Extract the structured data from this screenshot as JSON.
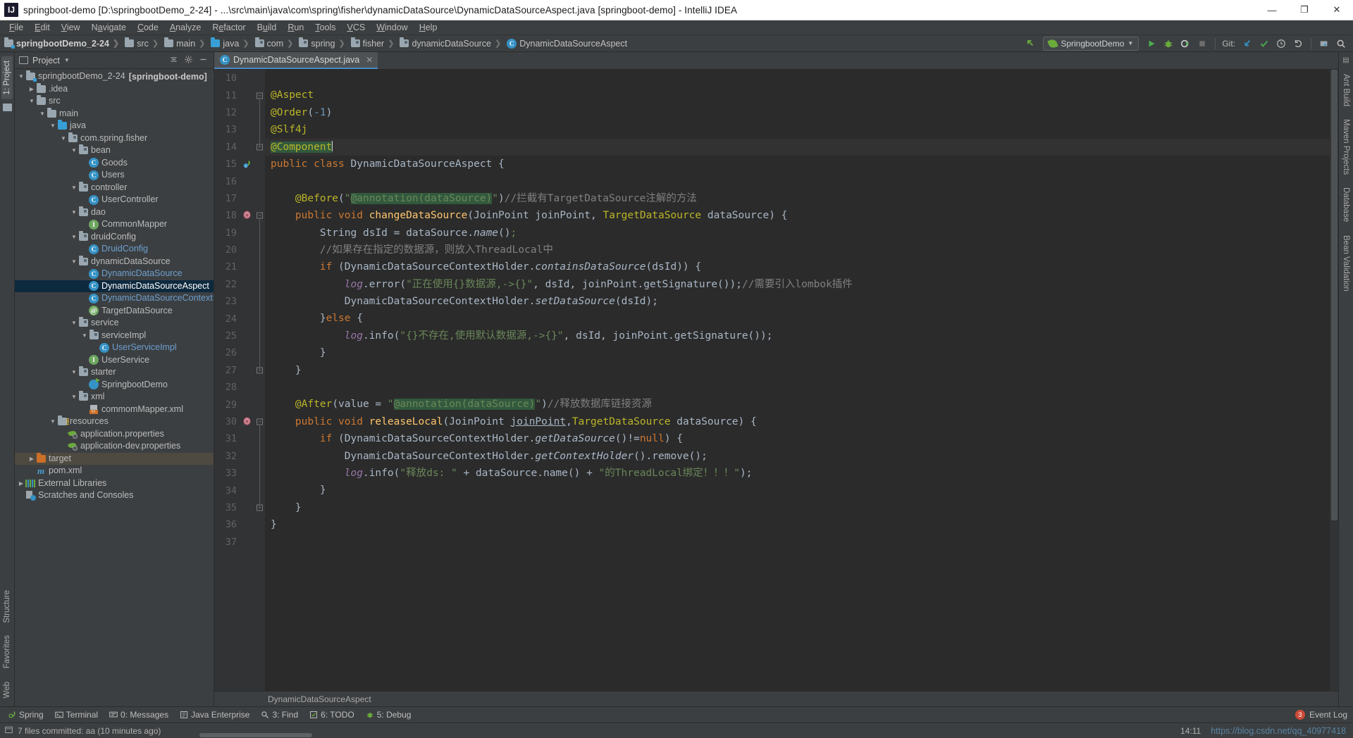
{
  "window": {
    "title": "springboot-demo [D:\\springbootDemo_2-24] - ...\\src\\main\\java\\com\\spring\\fisher\\dynamicDataSource\\DynamicDataSourceAspect.java [springboot-demo] - IntelliJ IDEA",
    "logo_text": "IJ",
    "minimize": "—",
    "maximize": "❐",
    "close": "✕"
  },
  "menubar": {
    "items": [
      "File",
      "Edit",
      "View",
      "Navigate",
      "Code",
      "Analyze",
      "Refactor",
      "Build",
      "Run",
      "Tools",
      "VCS",
      "Window",
      "Help"
    ]
  },
  "navbar": {
    "crumbs": [
      {
        "label": "springbootDemo_2-24",
        "icon": "folder-module-icon",
        "bold": true,
        "kind": "module"
      },
      {
        "label": "src",
        "icon": "folder-icon",
        "bold": false,
        "kind": "folder"
      },
      {
        "label": "main",
        "icon": "folder-icon",
        "bold": false,
        "kind": "folder"
      },
      {
        "label": "java",
        "icon": "folder-source-icon",
        "bold": false,
        "kind": "source"
      },
      {
        "label": "com",
        "icon": "folder-package-icon",
        "bold": false,
        "kind": "package"
      },
      {
        "label": "spring",
        "icon": "folder-package-icon",
        "bold": false,
        "kind": "package"
      },
      {
        "label": "fisher",
        "icon": "folder-package-icon",
        "bold": false,
        "kind": "package"
      },
      {
        "label": "dynamicDataSource",
        "icon": "folder-package-icon",
        "bold": false,
        "kind": "package"
      },
      {
        "label": "DynamicDataSourceAspect",
        "icon": "class-icon",
        "bold": false,
        "kind": "class"
      }
    ],
    "run_config": "SpringbootDemo",
    "git_label": "Git:",
    "icons": {
      "back_arrow": "up-left-arrow-icon",
      "run": "run-icon",
      "debug": "debug-icon",
      "run_coverage": "run-with-coverage-icon",
      "stop": "stop-icon",
      "update": "git-update-icon",
      "commit": "git-commit-icon",
      "history": "git-history-icon",
      "rollback": "git-rollback-icon",
      "project_struct": "project-structure-icon",
      "search": "search-everywhere-icon"
    }
  },
  "left_strips": [
    "1: Project",
    "Structure",
    "Favorites",
    "Web"
  ],
  "right_strips": [
    "Ant Build",
    "Maven Projects",
    "Database",
    "Bean Validation"
  ],
  "project_panel": {
    "title": "Project",
    "tree": [
      {
        "depth": 0,
        "tri": "▼",
        "icon": "module-icon",
        "label": "springbootDemo_2-24",
        "bold_suffix": "[springboot-demo]",
        "path": "D:\\spring",
        "state": "normal"
      },
      {
        "depth": 1,
        "tri": "▶",
        "icon": "folder-icon",
        "label": ".idea",
        "state": "normal"
      },
      {
        "depth": 1,
        "tri": "▼",
        "icon": "folder-icon",
        "label": "src",
        "state": "normal"
      },
      {
        "depth": 2,
        "tri": "▼",
        "icon": "folder-icon",
        "label": "main",
        "state": "normal"
      },
      {
        "depth": 3,
        "tri": "▼",
        "icon": "folder-source-icon",
        "label": "java",
        "state": "normal"
      },
      {
        "depth": 4,
        "tri": "▼",
        "icon": "folder-package-icon",
        "label": "com.spring.fisher",
        "state": "normal"
      },
      {
        "depth": 5,
        "tri": "▼",
        "icon": "folder-package-icon",
        "label": "bean",
        "state": "normal"
      },
      {
        "depth": 6,
        "tri": "",
        "icon": "class-icon",
        "label": "Goods",
        "state": "normal"
      },
      {
        "depth": 6,
        "tri": "",
        "icon": "class-icon",
        "label": "Users",
        "state": "normal"
      },
      {
        "depth": 5,
        "tri": "▼",
        "icon": "folder-package-icon",
        "label": "controller",
        "state": "normal"
      },
      {
        "depth": 6,
        "tri": "",
        "icon": "class-icon",
        "label": "UserController",
        "state": "normal"
      },
      {
        "depth": 5,
        "tri": "▼",
        "icon": "folder-package-icon",
        "label": "dao",
        "state": "normal"
      },
      {
        "depth": 6,
        "tri": "",
        "icon": "interface-icon",
        "label": "CommonMapper",
        "state": "normal"
      },
      {
        "depth": 5,
        "tri": "▼",
        "icon": "folder-package-icon",
        "label": "druidConfig",
        "state": "normal"
      },
      {
        "depth": 6,
        "tri": "",
        "icon": "class-icon",
        "label": "DruidConfig",
        "state": "blue"
      },
      {
        "depth": 5,
        "tri": "▼",
        "icon": "folder-package-icon",
        "label": "dynamicDataSource",
        "state": "normal"
      },
      {
        "depth": 6,
        "tri": "",
        "icon": "class-icon",
        "label": "DynamicDataSource",
        "state": "blue"
      },
      {
        "depth": 6,
        "tri": "",
        "icon": "class-icon",
        "label": "DynamicDataSourceAspect",
        "state": "selected"
      },
      {
        "depth": 6,
        "tri": "",
        "icon": "class-icon",
        "label": "DynamicDataSourceContextHolder",
        "state": "blue"
      },
      {
        "depth": 6,
        "tri": "",
        "icon": "annotation-icon",
        "label": "TargetDataSource",
        "state": "normal"
      },
      {
        "depth": 5,
        "tri": "▼",
        "icon": "folder-package-icon",
        "label": "service",
        "state": "normal"
      },
      {
        "depth": 6,
        "tri": "▼",
        "icon": "folder-package-icon",
        "label": "serviceImpl",
        "state": "normal"
      },
      {
        "depth": 7,
        "tri": "",
        "icon": "class-icon",
        "label": "UserServiceImpl",
        "state": "blue"
      },
      {
        "depth": 6,
        "tri": "",
        "icon": "interface-icon",
        "label": "UserService",
        "state": "normal"
      },
      {
        "depth": 5,
        "tri": "▼",
        "icon": "folder-package-icon",
        "label": "starter",
        "state": "normal"
      },
      {
        "depth": 6,
        "tri": "",
        "icon": "spring-boot-icon",
        "label": "SpringbootDemo",
        "state": "normal"
      },
      {
        "depth": 5,
        "tri": "▼",
        "icon": "folder-package-icon",
        "label": "xml",
        "state": "normal"
      },
      {
        "depth": 6,
        "tri": "",
        "icon": "xml-file-icon",
        "label": "commomMapper.xml",
        "state": "normal"
      },
      {
        "depth": 3,
        "tri": "▼",
        "icon": "folder-resources-icon",
        "label": "resources",
        "state": "normal"
      },
      {
        "depth": 4,
        "tri": "",
        "icon": "properties-icon",
        "label": "application.properties",
        "state": "normal"
      },
      {
        "depth": 4,
        "tri": "",
        "icon": "properties-icon",
        "label": "application-dev.properties",
        "state": "normal"
      },
      {
        "depth": 1,
        "tri": "▶",
        "icon": "folder-excluded-icon",
        "label": "target",
        "state": "highlighted"
      },
      {
        "depth": 1,
        "tri": "",
        "icon": "maven-icon",
        "label": "pom.xml",
        "state": "normal"
      },
      {
        "depth": 0,
        "tri": "▶",
        "icon": "libraries-icon",
        "label": "External Libraries",
        "state": "normal"
      },
      {
        "depth": 0,
        "tri": "",
        "icon": "scratches-icon",
        "label": "Scratches and Consoles",
        "state": "normal"
      }
    ]
  },
  "editor": {
    "tab": {
      "label": "DynamicDataSourceAspect.java",
      "icon": "class-icon",
      "close": "✕"
    },
    "breadcrumb": "DynamicDataSourceAspect",
    "first_line": 10,
    "lines": [
      {
        "n": 10,
        "html": "",
        "current": false,
        "fold": "",
        "mark": ""
      },
      {
        "n": 11,
        "html": "<span class='ann'>@Aspect</span>",
        "current": false,
        "fold": "minus-top",
        "mark": ""
      },
      {
        "n": 12,
        "html": "<span class='ann'>@Order</span>(<span class='num'>-1</span>)",
        "current": false,
        "fold": "",
        "mark": ""
      },
      {
        "n": 13,
        "html": "<span class='ann'>@Slf4j</span>",
        "current": false,
        "fold": "",
        "mark": ""
      },
      {
        "n": 14,
        "html": "<span class='ann hlbg'>@Component</span><span class='caret'></span>",
        "current": true,
        "fold": "minus-bot",
        "mark": ""
      },
      {
        "n": 15,
        "html": "<span class='kw'>public class</span> <span class='cls'>DynamicDataSourceAspect</span> {",
        "current": false,
        "fold": "",
        "mark": "spring-bean-icon"
      },
      {
        "n": 16,
        "html": "",
        "current": false,
        "fold": "",
        "mark": ""
      },
      {
        "n": 17,
        "html": "    <span class='ann'>@Before</span>(<span class='str'>\"</span><span class='str hlbg'>@annotation(dataSource)</span><span class='str'>\"</span>)<span class='cmt'>//拦截有TargetDataSource注解的方法</span>",
        "current": false,
        "fold": "",
        "mark": ""
      },
      {
        "n": 18,
        "html": "    <span class='kw'>public void</span> <span class='fn'>changeDataSource</span>(<span class='cls'>JoinPoint</span> <span class='param'>joinPoint</span>, <span class='ann'>TargetDataSource</span> <span class='param'>dataSource</span>) {",
        "current": false,
        "fold": "minus-top",
        "mark": "method-override-icon"
      },
      {
        "n": 19,
        "html": "        <span class='cls'>String</span> dsId = dataSource.<span class='sfn'>name</span>()<span class='str'>;</span>",
        "current": false,
        "fold": "",
        "mark": ""
      },
      {
        "n": 20,
        "html": "        <span class='cmt'>//如果存在指定的数据源，则放入ThreadLocal中</span>",
        "current": false,
        "fold": "",
        "mark": ""
      },
      {
        "n": 21,
        "html": "        <span class='kw'>if</span> (DynamicDataSourceContextHolder.<span class='sfn'>containsDataSource</span>(dsId)) {",
        "current": false,
        "fold": "",
        "mark": ""
      },
      {
        "n": 22,
        "html": "            <span class='fld'>log</span>.error(<span class='str'>\"正在使用{}数据源,-&gt;{}\"</span>, dsId, joinPoint.getSignature());<span class='cmt'>//需要引入lombok插件</span>",
        "current": false,
        "fold": "",
        "mark": ""
      },
      {
        "n": 23,
        "html": "            DynamicDataSourceContextHolder.<span class='sfn'>setDataSource</span>(dsId);",
        "current": false,
        "fold": "",
        "mark": ""
      },
      {
        "n": 24,
        "html": "        }<span class='kw'>else</span> {",
        "current": false,
        "fold": "",
        "mark": ""
      },
      {
        "n": 25,
        "html": "            <span class='fld'>log</span>.info(<span class='str'>\"{}不存在,使用默认数据源,-&gt;{}\"</span>, dsId, joinPoint.getSignature());",
        "current": false,
        "fold": "",
        "mark": ""
      },
      {
        "n": 26,
        "html": "        }",
        "current": false,
        "fold": "",
        "mark": ""
      },
      {
        "n": 27,
        "html": "    }",
        "current": false,
        "fold": "minus-bot",
        "mark": ""
      },
      {
        "n": 28,
        "html": "",
        "current": false,
        "fold": "",
        "mark": ""
      },
      {
        "n": 29,
        "html": "    <span class='ann'>@After</span>(value = <span class='str'>\"</span><span class='str hlbg'>@annotation(dataSource)</span><span class='str'>\"</span>)<span class='cmt'>//释放数据库链接资源</span>",
        "current": false,
        "fold": "",
        "mark": ""
      },
      {
        "n": 30,
        "html": "    <span class='kw'>public void</span> <span class='fn'>releaseLocal</span>(<span class='cls'>JoinPoint</span> <span class='param uline'>joinPoint</span>,<span class='ann'>TargetDataSource</span> <span class='param'>dataSource</span>) {",
        "current": false,
        "fold": "minus-top",
        "mark": "method-override-icon"
      },
      {
        "n": 31,
        "html": "        <span class='kw'>if</span> (DynamicDataSourceContextHolder.<span class='sfn'>getDataSource</span>()!=<span class='kw'>null</span>) {",
        "current": false,
        "fold": "",
        "mark": ""
      },
      {
        "n": 32,
        "html": "            DynamicDataSourceContextHolder.<span class='sfn'>getContextHolder</span>().remove();",
        "current": false,
        "fold": "",
        "mark": ""
      },
      {
        "n": 33,
        "html": "            <span class='fld'>log</span>.info(<span class='str'>\"释放ds: \"</span> + dataSource.name() + <span class='str'>\"的ThreadLocal绑定！！！\"</span>);",
        "current": false,
        "fold": "",
        "mark": ""
      },
      {
        "n": 34,
        "html": "        }",
        "current": false,
        "fold": "",
        "mark": ""
      },
      {
        "n": 35,
        "html": "    }",
        "current": false,
        "fold": "minus-bot",
        "mark": ""
      },
      {
        "n": 36,
        "html": "}",
        "current": false,
        "fold": "",
        "mark": ""
      },
      {
        "n": 37,
        "html": "",
        "current": false,
        "fold": "",
        "mark": ""
      }
    ]
  },
  "bottom_bar": {
    "items": [
      {
        "label": "Spring",
        "icon": "spring-icon"
      },
      {
        "label": "Terminal",
        "icon": "terminal-icon"
      },
      {
        "label": "0: Messages",
        "icon": "messages-icon"
      },
      {
        "label": "Java Enterprise",
        "icon": "java-enterprise-icon"
      },
      {
        "label": "3: Find",
        "icon": "find-icon"
      },
      {
        "label": "6: TODO",
        "icon": "todo-icon"
      },
      {
        "label": "5: Debug",
        "icon": "debug-icon"
      }
    ],
    "event_log": {
      "label": "Event Log",
      "count": "3"
    }
  },
  "statusbar": {
    "message": "7 files committed: aa (10 minutes ago)",
    "caret_position": "14:11",
    "watermark": "https://blog.csdn.net/qq_40977418"
  },
  "colors": {
    "accent_blue": "#4a88c7",
    "selection": "#0d293e",
    "editor_bg": "#2b2b2b",
    "panel_bg": "#3c3f41",
    "gutter_bg": "#313335",
    "annotation": "#bbb529",
    "keyword": "#cc7832",
    "string": "#6a8759",
    "comment": "#808080",
    "number": "#6897bb",
    "method": "#ffc66d",
    "field": "#9876aa",
    "error_red": "#cc4b37",
    "green": "#6aab3c"
  }
}
